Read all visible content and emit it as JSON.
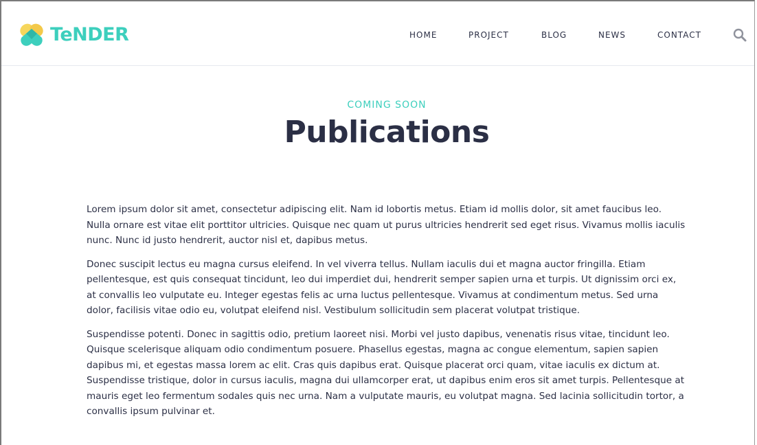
{
  "brand": {
    "name": "TeNDER",
    "colors": {
      "accent": "#3dcfbd",
      "accent_dark": "#2fb7a7",
      "yellow": "#f6d65c",
      "text": "#2b2f45"
    }
  },
  "nav": {
    "items": [
      {
        "label": "HOME"
      },
      {
        "label": "PROJECT"
      },
      {
        "label": "BLOG"
      },
      {
        "label": "NEWS"
      },
      {
        "label": "CONTACT"
      }
    ],
    "search_icon": "search-icon"
  },
  "hero": {
    "kicker": "COMING SOON",
    "title": "Publications"
  },
  "content": {
    "paragraphs": [
      "Lorem ipsum dolor sit amet, consectetur adipiscing elit. Nam id lobortis metus. Etiam id mollis dolor, sit amet faucibus leo. Nulla ornare est vitae elit porttitor ultricies. Quisque nec quam ut purus ultricies hendrerit sed eget risus. Vivamus mollis iaculis nunc. Nunc id justo hendrerit, auctor nisl et, dapibus metus.",
      "Donec suscipit lectus eu magna cursus eleifend. In vel viverra tellus. Nullam iaculis dui et magna auctor fringilla. Etiam pellentesque, est quis consequat tincidunt, leo dui imperdiet dui, hendrerit semper sapien urna et turpis. Ut dignissim orci ex, at convallis leo vulputate eu. Integer egestas felis ac urna luctus pellentesque. Vivamus at condimentum metus. Sed urna dolor, facilisis vitae odio eu, volutpat eleifend nisl. Vestibulum sollicitudin sem placerat volutpat tristique.",
      "Suspendisse potenti. Donec in sagittis odio, pretium laoreet nisi. Morbi vel justo dapibus, venenatis risus vitae, tincidunt leo. Quisque scelerisque aliquam odio condimentum posuere. Phasellus egestas, magna ac congue elementum, sapien sapien dapibus mi, et egestas massa lorem ac elit. Cras quis dapibus erat. Quisque placerat orci quam, vitae iaculis ex dictum at. Suspendisse tristique, dolor in cursus iaculis, magna dui ullamcorper erat, ut dapibus enim eros sit amet turpis. Pellentesque at mauris eget leo fermentum sodales quis nec urna. Nam a vulputate mauris, eu volutpat magna. Sed lacinia sollicitudin tortor, a convallis ipsum pulvinar et."
    ]
  }
}
